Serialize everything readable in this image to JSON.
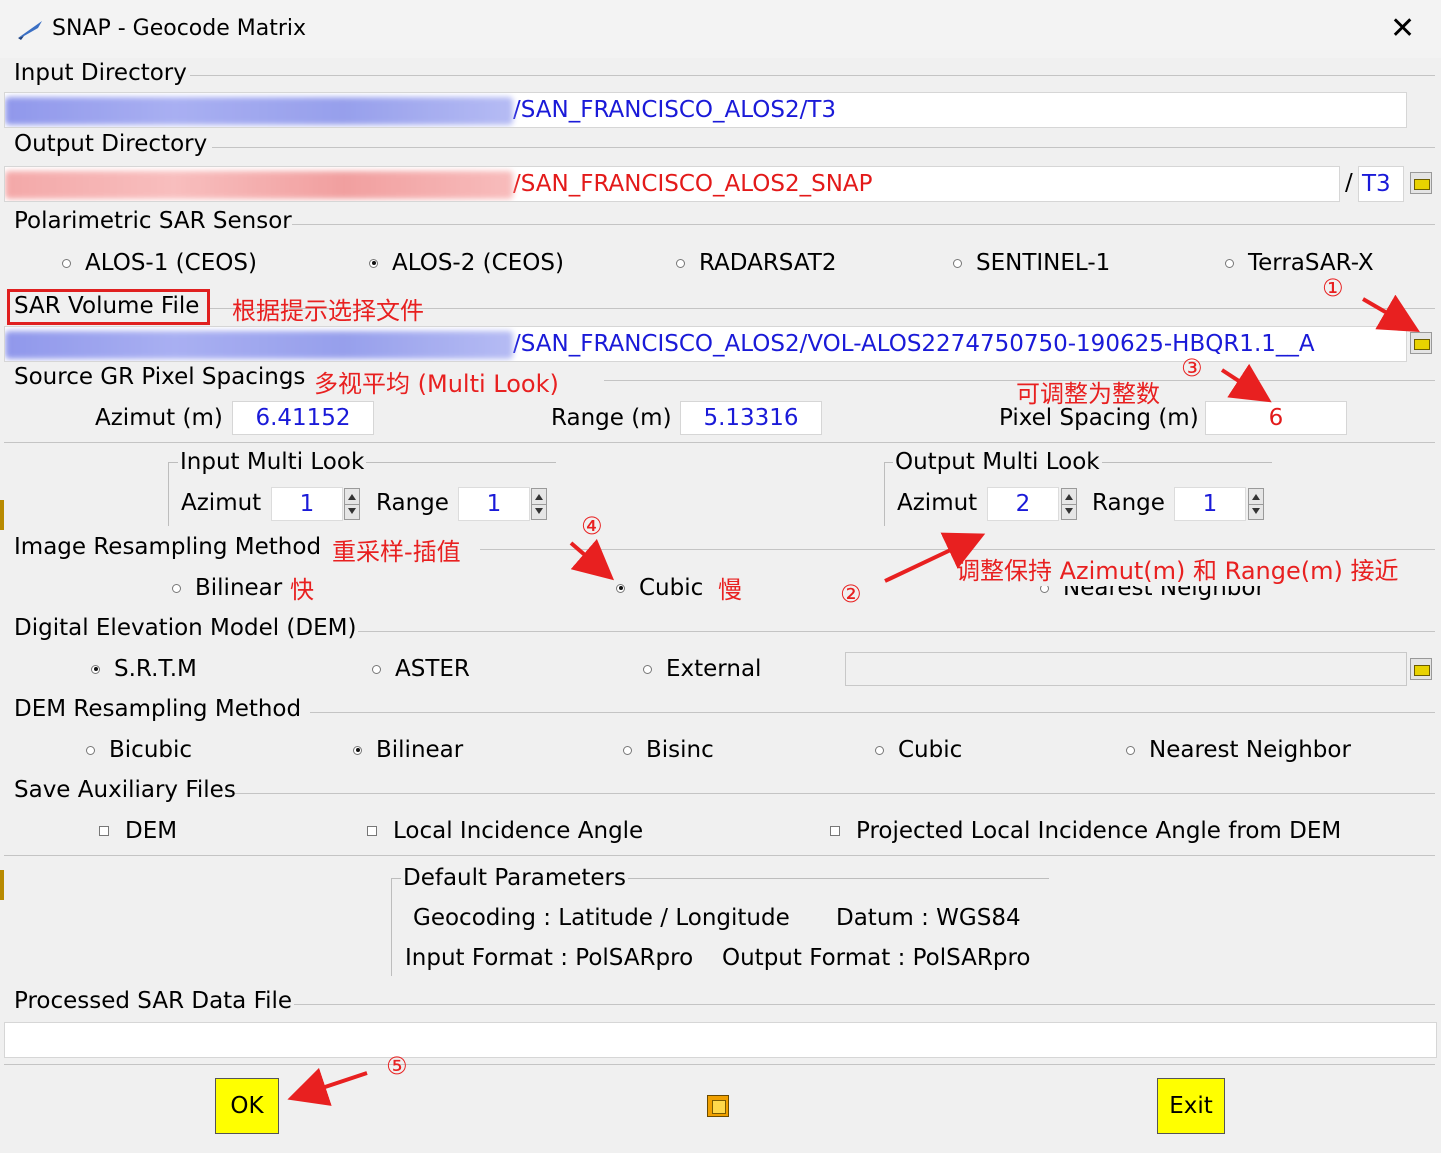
{
  "window": {
    "title": "SNAP - Geocode Matrix",
    "close_glyph": "✕"
  },
  "input_directory": {
    "label": "Input Directory",
    "path_visible": "/SAN_FRANCISCO_ALOS2/T3"
  },
  "output_directory": {
    "label": "Output Directory",
    "path_visible": "/SAN_FRANCISCO_ALOS2_SNAP",
    "separator": "/",
    "subdir": "T3"
  },
  "sensor": {
    "label": "Polarimetric SAR Sensor",
    "options": [
      "ALOS-1 (CEOS)",
      "ALOS-2 (CEOS)",
      "RADARSAT2",
      "SENTINEL-1",
      "TerraSAR-X"
    ],
    "selected": "ALOS-2 (CEOS)"
  },
  "sar_volume": {
    "label": "SAR Volume File",
    "path_visible": "/SAN_FRANCISCO_ALOS2/VOL-ALOS2274750750-190625-HBQR1.1__A"
  },
  "pixel_spacings": {
    "label": "Source GR Pixel Spacings",
    "azimut_label": "Azimut (m)",
    "azimut_value": "6.41152",
    "range_label": "Range (m)",
    "range_value": "5.13316",
    "spacing_label": "Pixel Spacing (m)",
    "spacing_value": "6"
  },
  "input_multilook": {
    "label": "Input Multi Look",
    "azimut_label": "Azimut",
    "azimut_value": "1",
    "range_label": "Range",
    "range_value": "1"
  },
  "output_multilook": {
    "label": "Output Multi Look",
    "azimut_label": "Azimut",
    "azimut_value": "2",
    "range_label": "Range",
    "range_value": "1"
  },
  "image_resampling": {
    "label": "Image Resampling Method",
    "options": [
      "Bilinear",
      "Cubic",
      "Nearest Neighbor"
    ],
    "selected": "Cubic"
  },
  "dem": {
    "label": "Digital Elevation Model (DEM)",
    "options": [
      "S.R.T.M",
      "ASTER",
      "External"
    ],
    "selected": "S.R.T.M"
  },
  "dem_resampling": {
    "label": "DEM Resampling Method",
    "options": [
      "Bicubic",
      "Bilinear",
      "Bisinc",
      "Cubic",
      "Nearest Neighbor"
    ],
    "selected": "Bilinear"
  },
  "aux_files": {
    "label": "Save Auxiliary Files",
    "options": [
      "DEM",
      "Local Incidence Angle",
      "Projected Local Incidence Angle from DEM"
    ]
  },
  "defaults": {
    "label": "Default Parameters",
    "geocoding": "Geocoding : Latitude / Longitude",
    "datum": "Datum : WGS84",
    "input_format": "Input Format : PolSARpro",
    "output_format": "Output Format : PolSARpro"
  },
  "processed": {
    "label": "Processed SAR Data File",
    "value": ""
  },
  "buttons": {
    "ok": "OK",
    "exit": "Exit"
  },
  "annotations": {
    "select_file": "根据提示选择文件",
    "multi_look": "多视平均 (Multi Look)",
    "adjust_integer": "可调整为整数",
    "resample": "重采样-插值",
    "fast": "快",
    "slow": "慢",
    "keep_close": "调整保持 Azimut(m) 和 Range(m) 接近",
    "n1": "①",
    "n2": "②",
    "n3": "③",
    "n4": "④",
    "n5": "⑤"
  },
  "colors": {
    "path_blue": "#1a1ad8",
    "path_red": "#e31a1a",
    "annotation_red": "#e82020",
    "button_yellow": "#ffff00"
  }
}
